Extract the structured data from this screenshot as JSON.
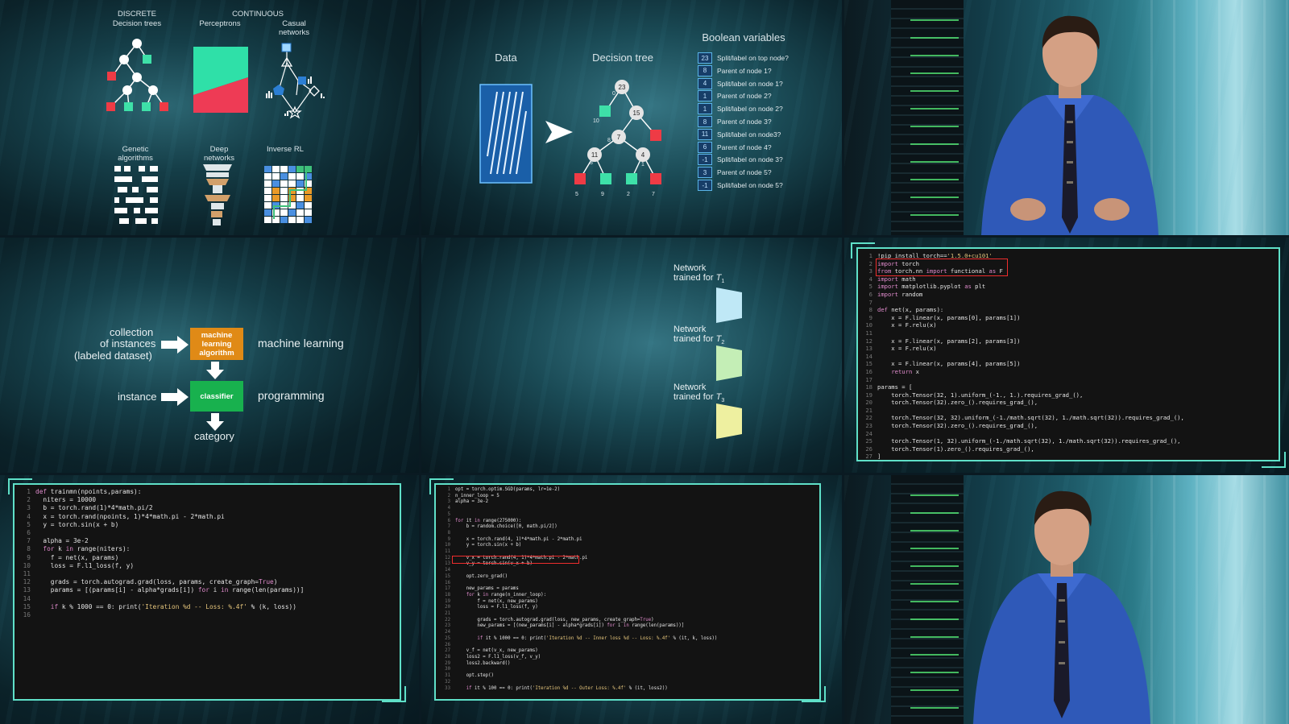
{
  "panel1": {
    "discrete": "DISCRETE",
    "continuous": "CONTINUOUS",
    "decision_trees": "Decision trees",
    "perceptrons": "Perceptrons",
    "casual_networks": "Casual networks",
    "genetic_algorithms": "Genetic algorithms",
    "deep_networks": "Deep networks",
    "inverse_rl": "Inverse RL"
  },
  "panel2": {
    "data": "Data",
    "decision_tree": "Decision tree",
    "boolean_variables": "Boolean variables",
    "tree_nodes": [
      "23",
      "15",
      "7",
      "11",
      "4"
    ],
    "edge_labels": [
      "0",
      "10",
      "6",
      "8",
      "3",
      "1"
    ],
    "leaf_labels": [
      "5",
      "9",
      "2",
      "7"
    ],
    "rows": [
      {
        "num": "23",
        "text": "Split/label on top node?"
      },
      {
        "num": "8",
        "text": "Parent of node 1?"
      },
      {
        "num": "4",
        "text": "Split/label on node 1?"
      },
      {
        "num": "1",
        "text": "Parent of node 2?"
      },
      {
        "num": "1",
        "text": "Split/label on node 2?"
      },
      {
        "num": "8",
        "text": "Parent of node 3?"
      },
      {
        "num": "11",
        "text": "Split/label on node3?"
      },
      {
        "num": "6",
        "text": "Parent of node 4?"
      },
      {
        "num": "-1",
        "text": "Split/label on node 3?"
      },
      {
        "num": "3",
        "text": "Parent of node 5?"
      },
      {
        "num": "-1",
        "text": "Split/label on node 5?"
      }
    ]
  },
  "panel4": {
    "collection": "collection",
    "of_instances": "of instances",
    "labeled_dataset": "(labeled dataset)",
    "ml_box": "machine learning algorithm",
    "machine_learning": "machine learning",
    "instance": "instance",
    "classifier": "classifier",
    "programming": "programming",
    "category": "category",
    "ml_color": "#e08a16",
    "classifier_color": "#18b14e"
  },
  "panel5": {
    "network": "Network",
    "trained_for": "trained for",
    "t1": "T",
    "t1_sub": "1",
    "t2_sub": "2",
    "t3_sub": "3",
    "t1_color": "#bfe8f6",
    "t2_color": "#c4eeb6",
    "t3_color": "#eef0a0"
  },
  "code_a": [
    "!pip install torch=='1.5.0+cu101'",
    "import torch",
    "from torch.nn import functional as F",
    "import math",
    "import matplotlib.pyplot as plt",
    "import random",
    "",
    "def net(x, params):",
    "    x = F.linear(x, params[0], params[1])",
    "    x = F.relu(x)",
    "",
    "    x = F.linear(x, params[2], params[3])",
    "    x = F.relu(x)",
    "",
    "    x = F.linear(x, params[4], params[5])",
    "    return x",
    "",
    "params = [",
    "    torch.Tensor(32, 1).uniform_(-1., 1.).requires_grad_(),",
    "    torch.Tensor(32).zero_().requires_grad_(),",
    "",
    "    torch.Tensor(32, 32).uniform_(-1./math.sqrt(32), 1./math.sqrt(32)).requires_grad_(),",
    "    torch.Tensor(32).zero_().requires_grad_(),",
    "",
    "    torch.Tensor(1, 32).uniform_(-1./math.sqrt(32), 1./math.sqrt(32)).requires_grad_(),",
    "    torch.Tensor(1).zero_().requires_grad_(),",
    "]"
  ],
  "code_b": [
    "def trainmn(npoints,params):",
    "  niters = 10000",
    "  b = torch.rand(1)*4*math.pi/2",
    "  x = torch.rand(npoints, 1)*4*math.pi - 2*math.pi",
    "  y = torch.sin(x + b)",
    "",
    "  alpha = 3e-2",
    "  for k in range(niters):",
    "    f = net(x, params)",
    "    loss = F.l1_loss(f, y)",
    "",
    "    grads = torch.autograd.grad(loss, params, create_graph=True)",
    "    params = [(params[i] - alpha*grads[i]) for i in range(len(params))]",
    "",
    "    if k % 1000 == 0: print('Iteration %d -- Loss: %.4f' % (k, loss))",
    ""
  ],
  "code_c": [
    "opt = torch.optim.SGD(params, lr=1e-2)",
    "n_inner_loop = 5",
    "alpha = 3e-2",
    "",
    "",
    "for it in range(275000):",
    "    b = random.choice([0, math.pi/2])",
    "",
    "    x = torch.rand(4, 1)*4*math.pi - 2*math.pi",
    "    y = torch.sin(x + b)",
    "",
    "    v_x = torch.rand(4, 1)*4*math.pi - 2*math.pi",
    "    v_y = torch.sin(v_x + b)",
    "",
    "    opt.zero_grad()",
    "",
    "    new_params = params",
    "    for k in range(n_inner_loop):",
    "        f = net(x, new_params)",
    "        loss = F.l1_loss(f, y)",
    "",
    "        grads = torch.autograd.grad(loss, new_params, create_graph=True)",
    "        new_params = [(new_params[i] - alpha*grads[i]) for i in range(len(params))]",
    "",
    "        if it % 1000 == 0: print('Iteration %d -- Inner loss %d -- Loss: %.4f' % (it, k, loss))",
    "",
    "    v_f = net(v_x, new_params)",
    "    loss2 = F.l1_loss(v_f, v_y)",
    "    loss2.backward()",
    "",
    "    opt.step()",
    "",
    "    if it % 100 == 0: print('Iteration %d -- Outer Loss: %.4f' % (it, loss2))"
  ],
  "colors": {
    "frame": "#5fe0c8",
    "highlight": "#ee2d2d",
    "tree_leaf_red": "#ee3b45",
    "tree_leaf_green": "#3ee0a8"
  }
}
